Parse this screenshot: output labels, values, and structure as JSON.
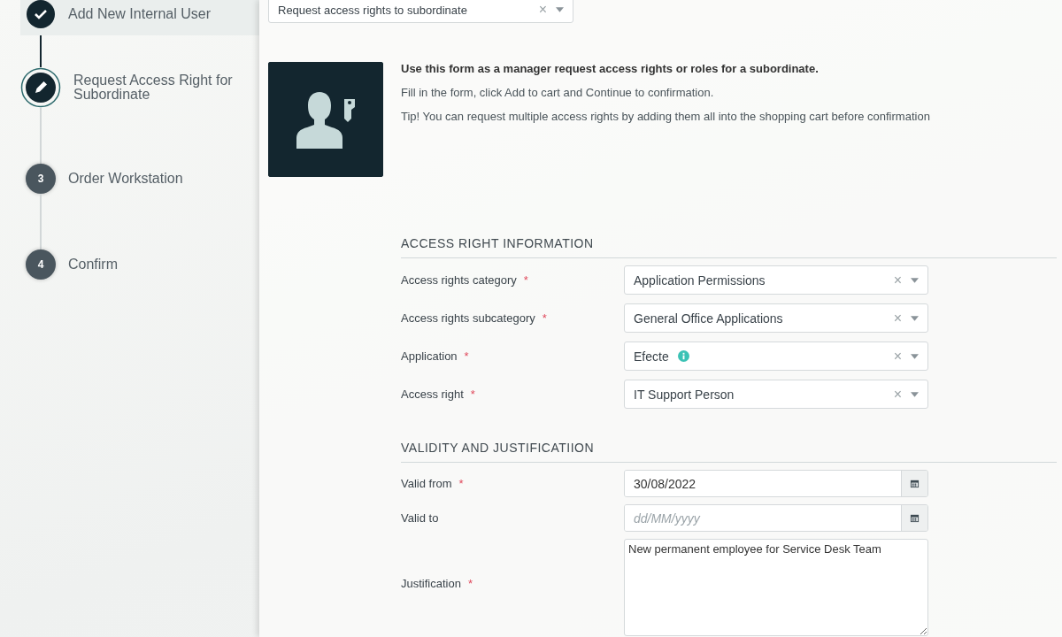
{
  "steps": [
    {
      "label": "Add New Internal User",
      "kind": "done"
    },
    {
      "label": "Request Access Right for Subordinate",
      "kind": "current"
    },
    {
      "label": "Order Workstation",
      "kind": "pending",
      "number": "3"
    },
    {
      "label": "Confirm",
      "kind": "pending",
      "number": "4"
    }
  ],
  "form_type": {
    "value": "Request access rights to subordinate",
    "clear": "×"
  },
  "intro": {
    "heading": "Use this form as a manager request access rights or roles for a subordinate.",
    "lines": [
      "Fill in the form, click Add to cart and Continue to confirmation.",
      "Tip! You can request multiple access rights by adding them all into the shopping cart before confirmation"
    ]
  },
  "sections": [
    {
      "title": "ACCESS RIGHT INFORMATION",
      "fields": [
        {
          "kind": "select",
          "label": "Access rights category",
          "required": "*",
          "value": "Application Permissions",
          "info": false,
          "clear": "×"
        },
        {
          "kind": "select",
          "label": "Access rights subcategory",
          "required": "*",
          "value": "General Office Applications",
          "info": false,
          "clear": "×"
        },
        {
          "kind": "select",
          "label": "Application",
          "required": "*",
          "value": "Efecte",
          "info": true,
          "clear": "×"
        },
        {
          "kind": "select",
          "label": "Access right",
          "required": "*",
          "value": "IT Support Person",
          "info": false,
          "clear": "×"
        }
      ]
    },
    {
      "title": "VALIDITY AND JUSTIFICATIION",
      "fields": [
        {
          "kind": "date",
          "label": "Valid from",
          "required": "*",
          "value": "30/08/2022"
        },
        {
          "kind": "date",
          "label": "Valid to",
          "placeholder": "dd/MM/yyyy"
        },
        {
          "kind": "textarea",
          "label": "Justification",
          "required": "*",
          "value": "New permanent employee for Service Desk Team"
        }
      ]
    }
  ]
}
